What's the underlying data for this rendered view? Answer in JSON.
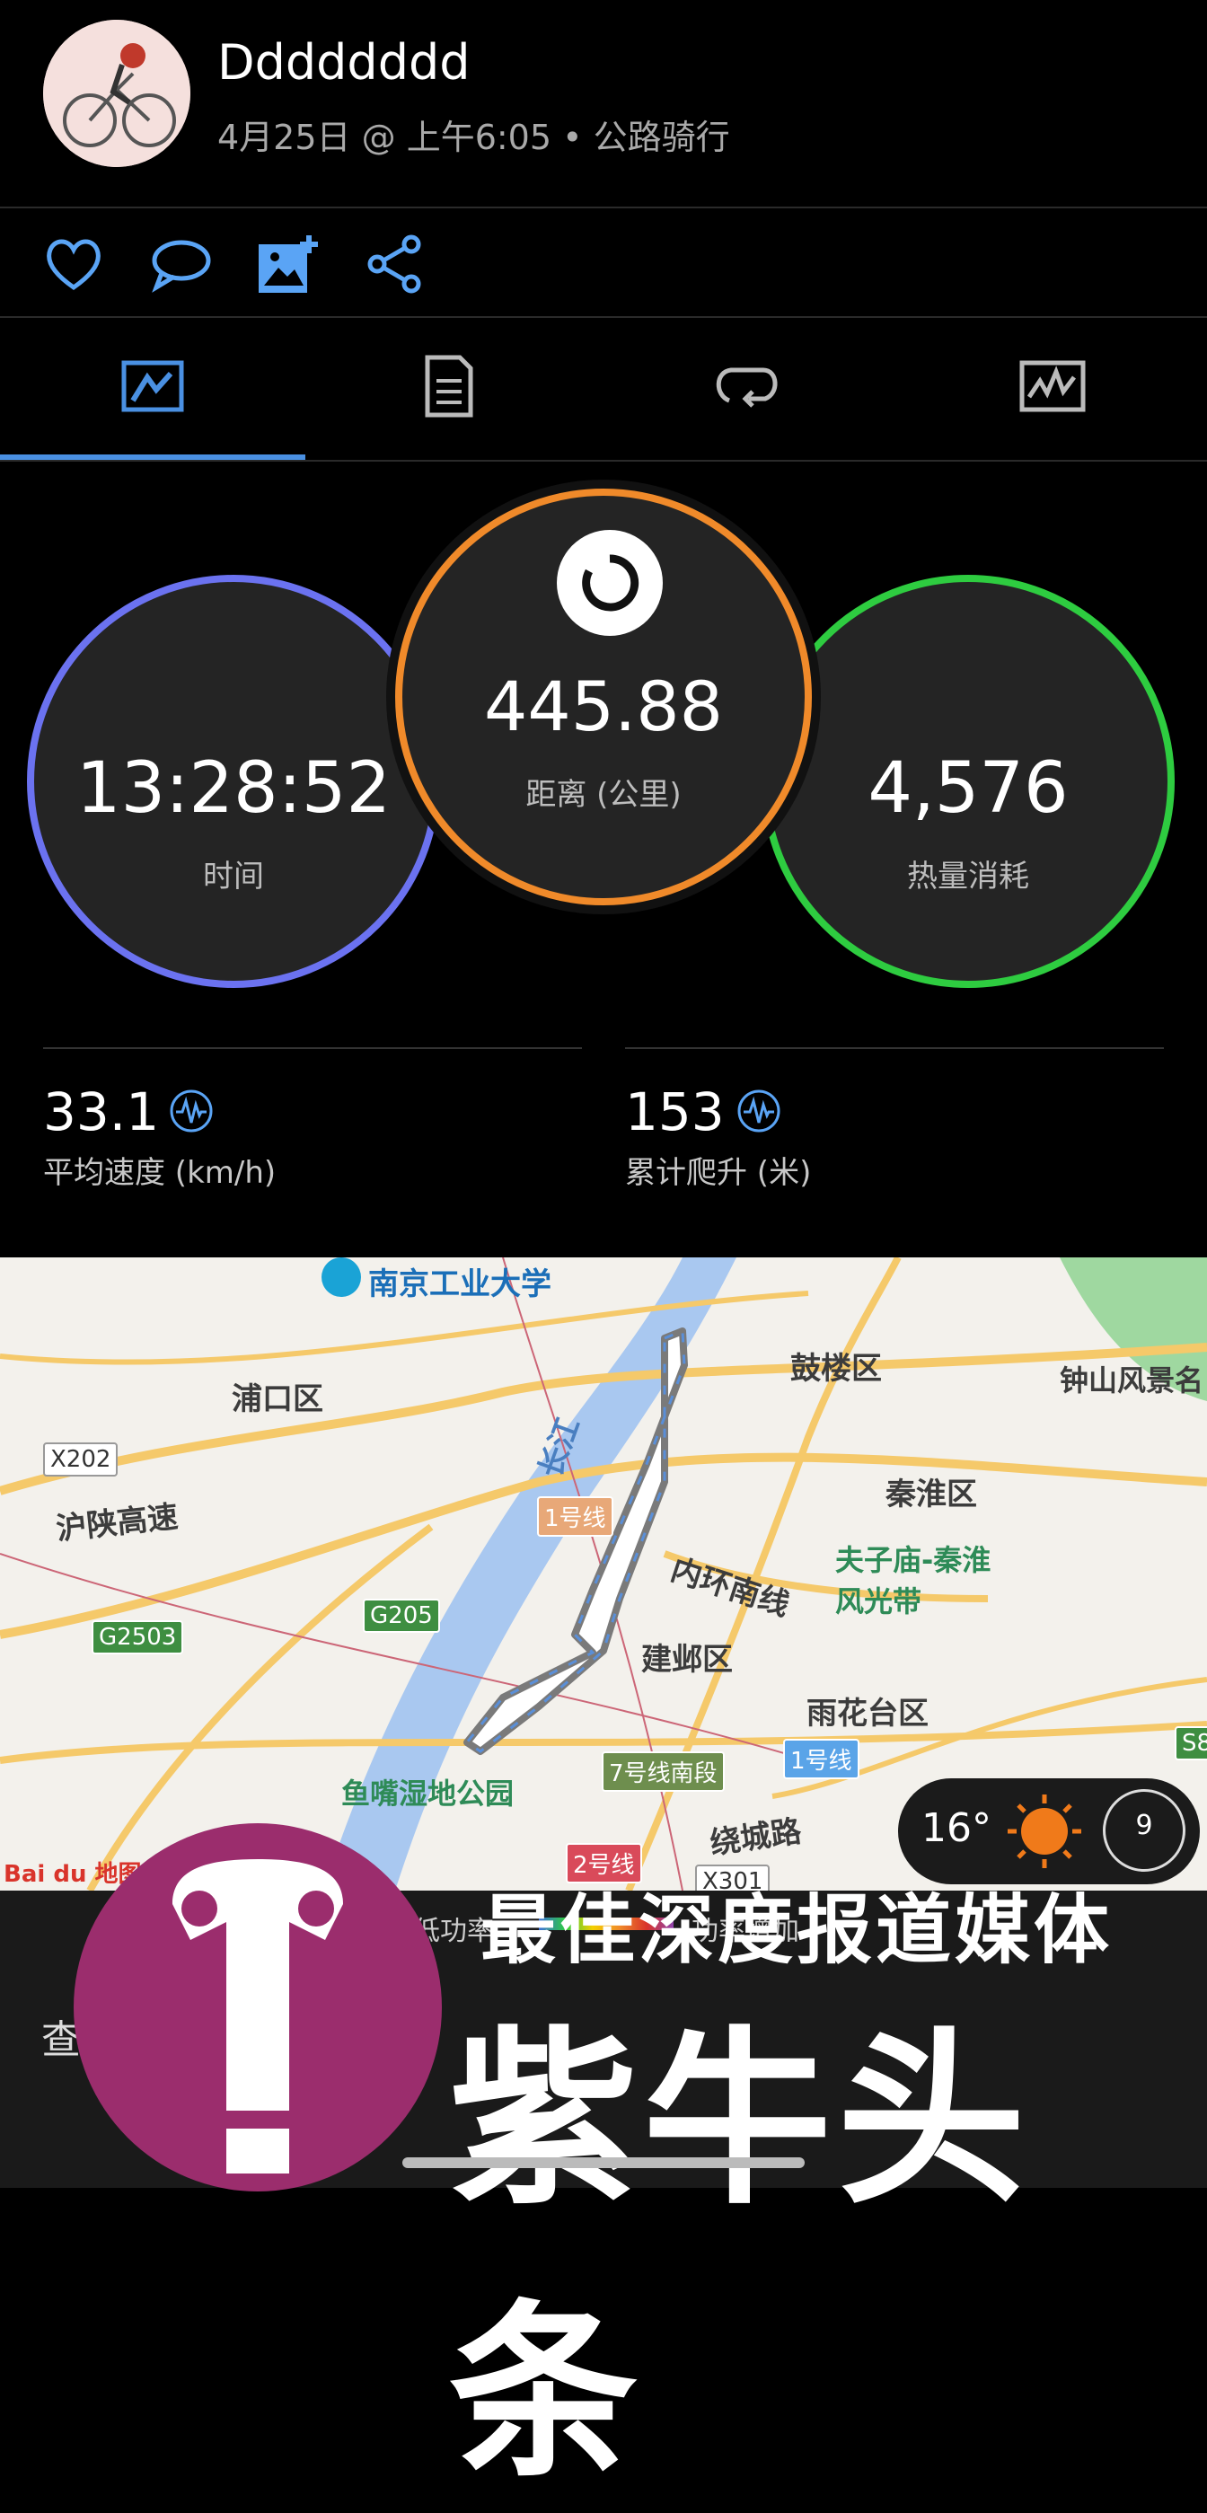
{
  "user": {
    "name": "Dddddddd",
    "meta": "4月25日 @ 上午6:05 • 公路骑行"
  },
  "actions": [
    {
      "icon": "heart-icon"
    },
    {
      "icon": "comment-icon"
    },
    {
      "icon": "add-photo-icon"
    },
    {
      "icon": "share-icon"
    }
  ],
  "tabs": [
    {
      "icon": "overview-icon",
      "active": true
    },
    {
      "icon": "details-icon",
      "active": false
    },
    {
      "icon": "laps-icon",
      "active": false
    },
    {
      "icon": "charts-icon",
      "active": false
    }
  ],
  "rings": {
    "time": {
      "value": "13:28:52",
      "label": "时间",
      "color": "#5b7cf5"
    },
    "distance": {
      "value": "445.88",
      "label": "距离 (公里)",
      "color": "#f08a2a"
    },
    "calories": {
      "value": "4,576",
      "label": "热量消耗",
      "color": "#2ecc40"
    }
  },
  "stats": {
    "avg_speed": {
      "value": "33.1",
      "label": "平均速度 (km/h)"
    },
    "elevation": {
      "value": "153",
      "label": "累计爬升 (米)"
    }
  },
  "map": {
    "labels": {
      "university": "南京工业大学",
      "pukou": "浦口区",
      "gulou": "鼓楼区",
      "zhongshan": "钟山风景名",
      "qinhuai": "秦淮区",
      "fuzimiao": "夫子庙-秦淮",
      "fengguang": "风光带",
      "neihuan": "内环南线",
      "jianye": "建邺区",
      "yuhuatai": "雨花台区",
      "huning": "沪陕高速",
      "yuzui": "鱼嘴湿地公园",
      "raocheng": "绕城路",
      "river": "长江",
      "line1": "1号线",
      "line1b": "1号线",
      "line7": "7号线南段",
      "line2": "2号线"
    },
    "road_tags": {
      "x202": "X202",
      "g2503": "G2503",
      "g205": "G205",
      "x301": "X301",
      "s8": "S8"
    },
    "logo": "Bai du 地图",
    "weather": {
      "temp": "16°",
      "wind": "9"
    },
    "bottom_left": "查",
    "legend_left": "低功率",
    "legend_right": "功率增加"
  },
  "banner": {
    "line1": "最佳深度报道媒体",
    "line2": "紫牛头条"
  }
}
